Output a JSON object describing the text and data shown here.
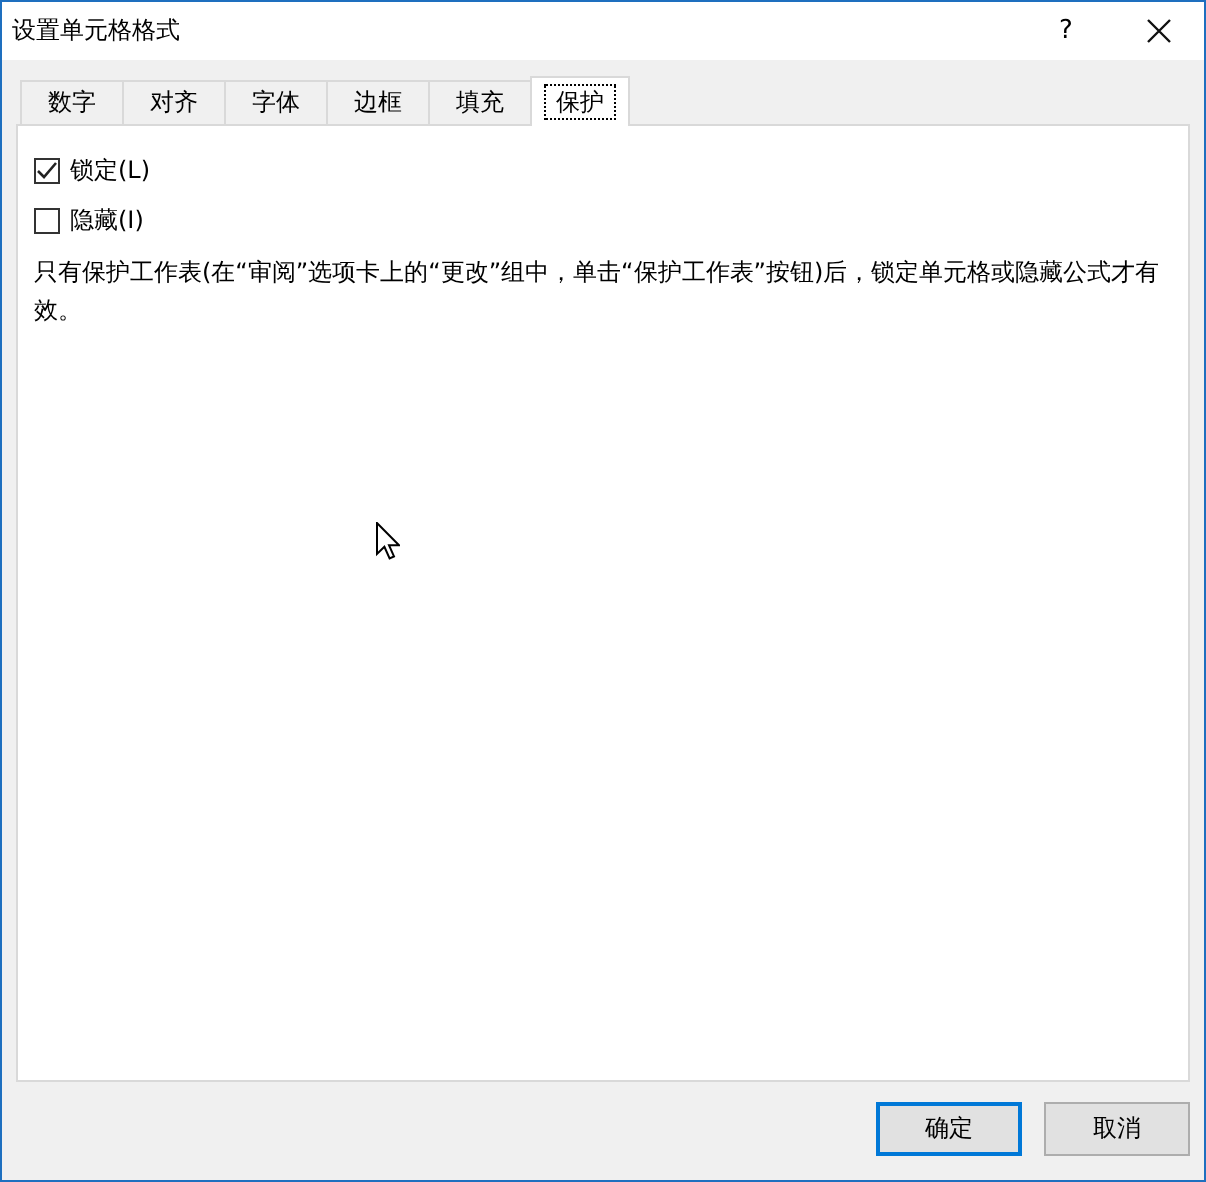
{
  "window": {
    "title": "设置单元格格式",
    "help": "?"
  },
  "tabs": [
    {
      "label": "数字",
      "selected": false
    },
    {
      "label": "对齐",
      "selected": false
    },
    {
      "label": "字体",
      "selected": false
    },
    {
      "label": "边框",
      "selected": false
    },
    {
      "label": "填充",
      "selected": false
    },
    {
      "label": "保护",
      "selected": true
    }
  ],
  "options": [
    {
      "label": "锁定(L)",
      "checked": true
    },
    {
      "label": "隐藏(I)",
      "checked": false
    }
  ],
  "note": "只有保护工作表(在“审阅”选项卡上的“更改”组中，单击“保护工作表”按钮)后，锁定单元格或隐藏公式才有效。",
  "buttons": [
    {
      "label": "确定",
      "default": true
    },
    {
      "label": "取消",
      "default": false
    }
  ]
}
